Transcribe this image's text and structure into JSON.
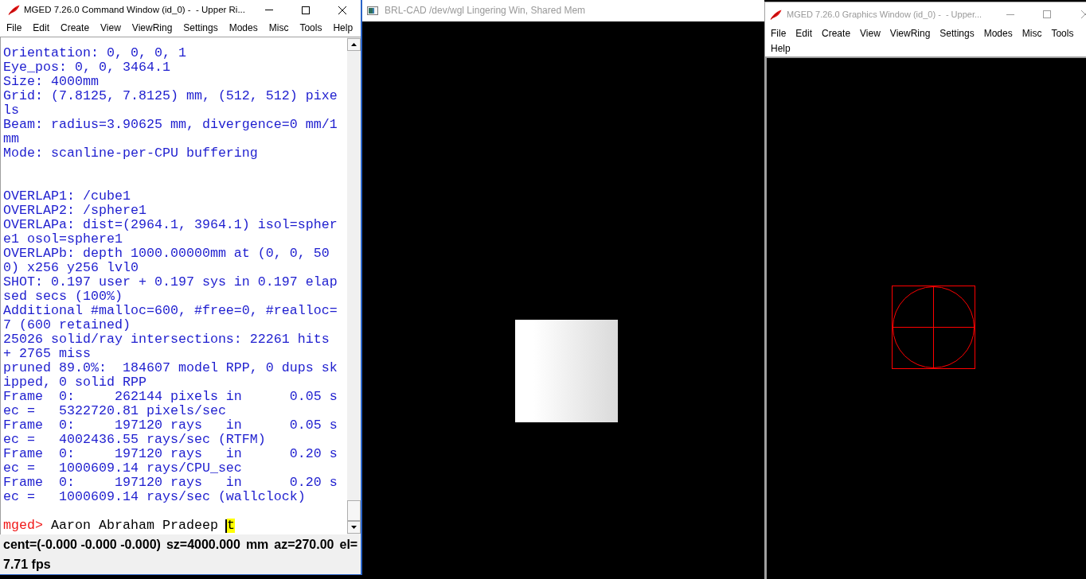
{
  "command_window": {
    "title": "MGED 7.26.0 Command Window (id_0) -  - Upper Ri...",
    "active": true,
    "menu": [
      "File",
      "Edit",
      "Create",
      "View",
      "ViewRing",
      "Settings",
      "Modes",
      "Misc",
      "Tools",
      "Help"
    ],
    "console": {
      "lines": [
        {
          "kind": "text",
          "text": "Orientation: 0, 0, 0, 1"
        },
        {
          "kind": "text",
          "text": "Eye_pos: 0, 0, 3464.1"
        },
        {
          "kind": "text",
          "text": "Size: 4000mm"
        },
        {
          "kind": "text",
          "text": "Grid: (7.8125, 7.8125) mm, (512, 512) pixels"
        },
        {
          "kind": "text",
          "text": "Beam: radius=3.90625 mm, divergence=0 mm/1mm"
        },
        {
          "kind": "text",
          "text": "Mode: scanline-per-CPU buffering"
        },
        {
          "kind": "blank"
        },
        {
          "kind": "blank"
        },
        {
          "kind": "text",
          "text": "OVERLAP1: /cube1"
        },
        {
          "kind": "text",
          "text": "OVERLAP2: /sphere1"
        },
        {
          "kind": "text",
          "text": "OVERLAPa: dist=(2964.1, 3964.1) isol=sphere1 osol=sphere1"
        },
        {
          "kind": "text",
          "text": "OVERLAPb: depth 1000.00000mm at (0, 0, 500) x256 y256 lvl0"
        },
        {
          "kind": "text",
          "text": "SHOT: 0.197 user + 0.197 sys in 0.197 elapsed secs (100%)"
        },
        {
          "kind": "text",
          "text": "Additional #malloc=600, #free=0, #realloc=7 (600 retained)"
        },
        {
          "kind": "text",
          "text": "25026 solid/ray intersections: 22261 hits + 2765 miss"
        },
        {
          "kind": "text",
          "text": "pruned 89.0%:  184607 model RPP, 0 dups skipped, 0 solid RPP"
        },
        {
          "kind": "text",
          "text": "Frame  0:     262144 pixels in      0.05 sec =   5322720.81 pixels/sec"
        },
        {
          "kind": "text",
          "text": "Frame  0:     197120 rays   in      0.05 sec =   4002436.55 rays/sec (RTFM)"
        },
        {
          "kind": "text",
          "text": "Frame  0:     197120 rays   in      0.20 sec =   1000609.14 rays/CPU_sec"
        },
        {
          "kind": "text",
          "text": "Frame  0:     197120 rays   in      0.20 sec =   1000609.14 rays/sec (wallclock)"
        },
        {
          "kind": "blank"
        }
      ],
      "prompt": {
        "label": "mged>",
        "input": "Aaron Abraham Pradeep",
        "cursor_char": "t"
      }
    },
    "status_bar": {
      "fields": [
        "cent=(-0.000 -0.000 -0.000)",
        "sz=4000.000",
        "mm",
        "az=270.00",
        "el="
      ],
      "fps": "7.71 fps"
    }
  },
  "raytrace_window": {
    "title": "BRL-CAD /dev/wgl Lingering Win, Shared Mem",
    "active": false
  },
  "graphics_window": {
    "title": "MGED 7.26.0 Graphics Window (id_0) -  - Upper...",
    "active": false,
    "menu": [
      "File",
      "Edit",
      "Create",
      "View",
      "ViewRing",
      "Settings",
      "Modes",
      "Misc",
      "Tools",
      "Help"
    ]
  }
}
